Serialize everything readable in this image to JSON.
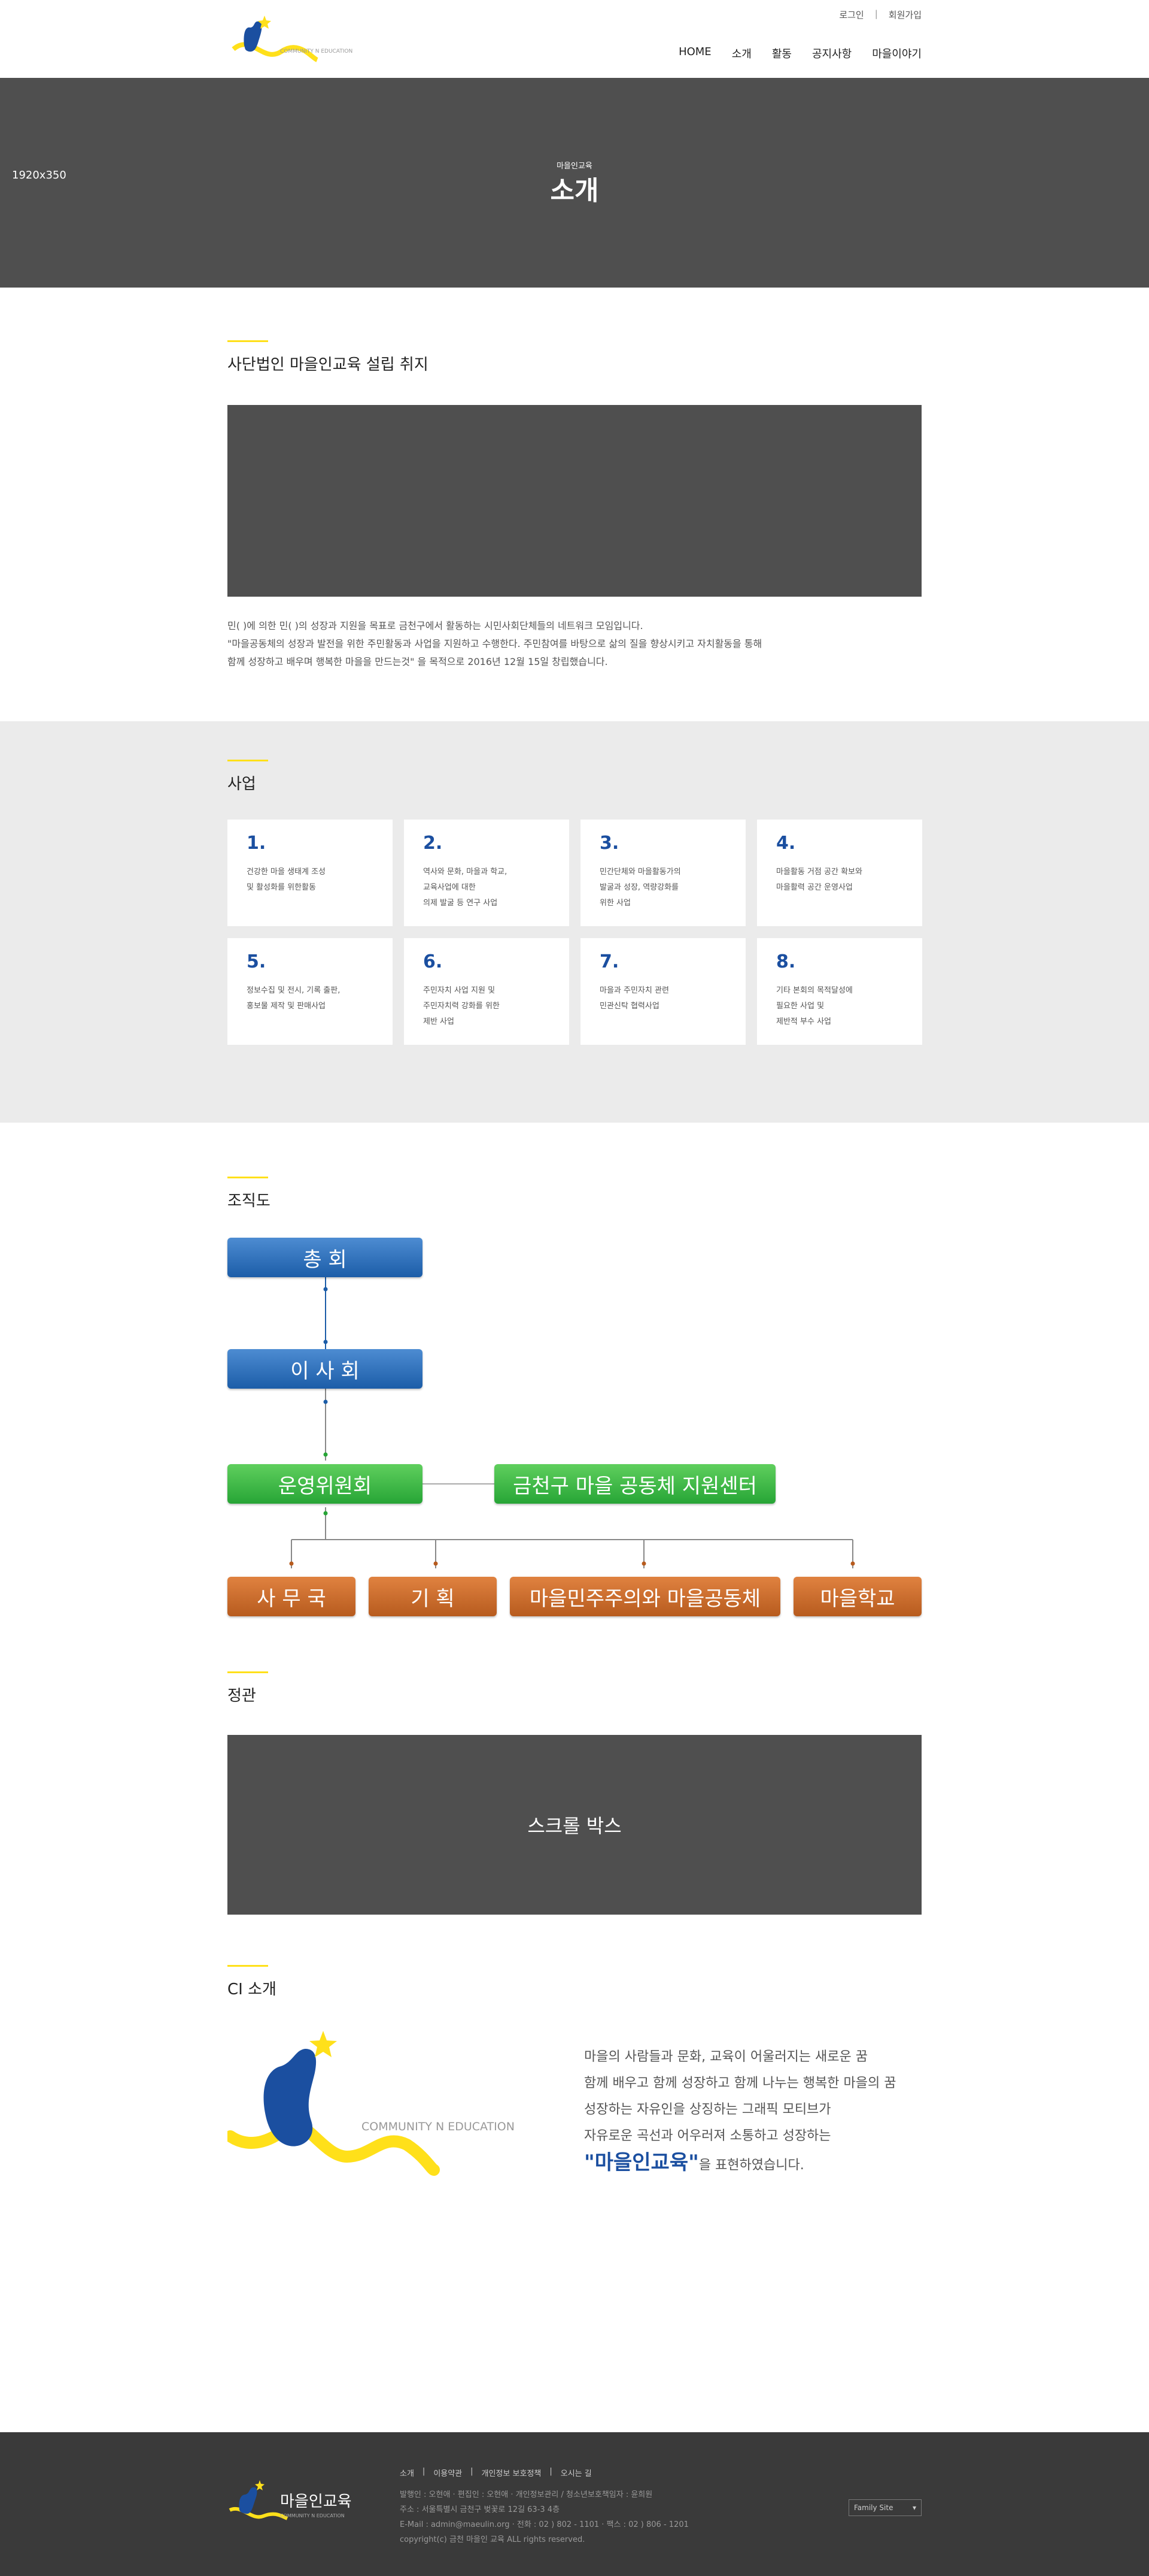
{
  "header": {
    "util": [
      "로그인",
      "회원가입"
    ],
    "logo_text": "COMMUNITY N EDUCATION",
    "nav": [
      "HOME",
      "소개",
      "활동",
      "공지사항",
      "마을이야기"
    ],
    "size_tag": "1920x350"
  },
  "visual": {
    "sub": "마을인교육",
    "title": "소개"
  },
  "intro": {
    "title": "사단법인 마을인교육 설립 취지",
    "lines": [
      "민(    )에 의한 민(    )의 성장과 지원을 목표로 금천구에서 활동하는 시민사회단체들의 네트워크 모임입니다.",
      "\"마을공동체의 성장과 발전을 위한 주민활동과 사업을 지원하고 수행한다. 주민참여를 바탕으로 삶의 질을 향상시키고 자치활동을 통해",
      "함께 성장하고 배우며 행복한 마을을 만드는것\" 을 목적으로 2016년 12월 15일 창립했습니다."
    ]
  },
  "business": {
    "title": "사업",
    "items": [
      {
        "num": "1.",
        "text": "건강한 마을 생태계 조성\n및 활성화를 위한활동"
      },
      {
        "num": "2.",
        "text": "역사와 문화, 마을과 학교,\n교육사업에 대한\n의제 발굴 등 연구 사업"
      },
      {
        "num": "3.",
        "text": "민간단체와 마을활동가의\n발굴과 성장, 역량강화를\n위한 사업"
      },
      {
        "num": "4.",
        "text": "마을활동 거점 공간 확보와\n마을활력 공간 운영사업"
      },
      {
        "num": "5.",
        "text": "정보수집 및 전시, 기록 출판,\n홍보물 제작 및 판매사업"
      },
      {
        "num": "6.",
        "text": "주민자치 사업 지원 및\n주민자치력 강화를 위한\n제반 사업"
      },
      {
        "num": "7.",
        "text": "마을과 주민자치 관련\n민관신탁 협력사업"
      },
      {
        "num": "8.",
        "text": "기타 본회의 목적달성에\n필요한 사업 및\n제반적 부수 사업"
      }
    ]
  },
  "org": {
    "title": "조직도",
    "general": "총 회",
    "board": "이 사 회",
    "committee": "운영위원회",
    "center": "금천구 마을 공동체 지원센터",
    "departments": [
      "사 무 국",
      "기 획",
      "마을민주주의와 마을공동체",
      "마을학교"
    ],
    "colors": {
      "blue": "#1c5da8",
      "green": "#27a536",
      "orange": "#b75b1e"
    }
  },
  "law": {
    "title": "정관",
    "scroll_label": "스크롤 박스"
  },
  "ci": {
    "title": "CI 소개",
    "logo_text": "COMMUNITY N EDUCATION",
    "lines": [
      "마을의 사람들과 문화, 교육이 어울러지는 새로운 꿈",
      "함께 배우고 함께 성장하고 함께 나누는 행복한 마을의 꿈",
      "성장하는 자유인을 상징하는 그래픽 모티브가",
      "자유로운 곡선과 어우러져 소통하고 성장하는"
    ],
    "emphasis": "\"마을인교육\"",
    "tail": "을 표현하였습니다."
  },
  "footer": {
    "logo_name": "마을인교육",
    "logo_sub": "COMMUNITY N EDUCATION",
    "menu": [
      "소개",
      "이용약관",
      "개인정보 보호정책",
      "오시는 길"
    ],
    "info": [
      "발행인 : 오현애  ·  편집인 : 오현애  ·  개인정보관리 / 청소년보호책임자 : 윤희원",
      "주소 : 서울특별시 금천구 벚꽃로 12길 63-3 4층",
      "E-Mail : admin@maeulin.org  ·  전화 : 02 ) 802 - 1101  ·  팩스 : 02 ) 806 - 1201",
      "copyright(c) 금천 마을인 교육 ALL rights reserved."
    ],
    "family_site": "Family Site"
  }
}
